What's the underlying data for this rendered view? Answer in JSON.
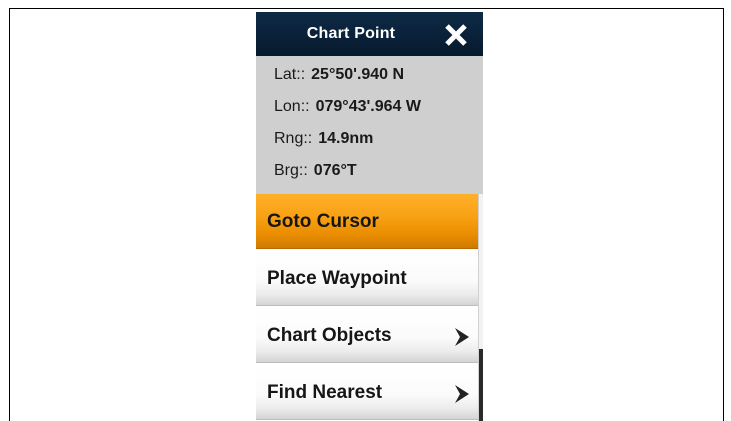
{
  "dialog": {
    "title": "Chart Point",
    "close_icon": "close-icon"
  },
  "info": [
    {
      "label": "Lat::",
      "value": "25°50'.940 N"
    },
    {
      "label": "Lon::",
      "value": "079°43'.964 W"
    },
    {
      "label": "Rng::",
      "value": "14.9nm"
    },
    {
      "label": "Brg::",
      "value": "076°T"
    }
  ],
  "menu": [
    {
      "label": "Goto Cursor",
      "active": true,
      "submenu": false
    },
    {
      "label": "Place Waypoint",
      "active": false,
      "submenu": false
    },
    {
      "label": "Chart Objects",
      "active": false,
      "submenu": true,
      "icon": "chevron-right-icon"
    },
    {
      "label": "Find Nearest",
      "active": false,
      "submenu": true,
      "icon": "chevron-right-icon"
    }
  ],
  "colors": {
    "titlebar": "#0a2139",
    "info_bg": "#cfcfcf",
    "highlight": "#f7a012"
  }
}
